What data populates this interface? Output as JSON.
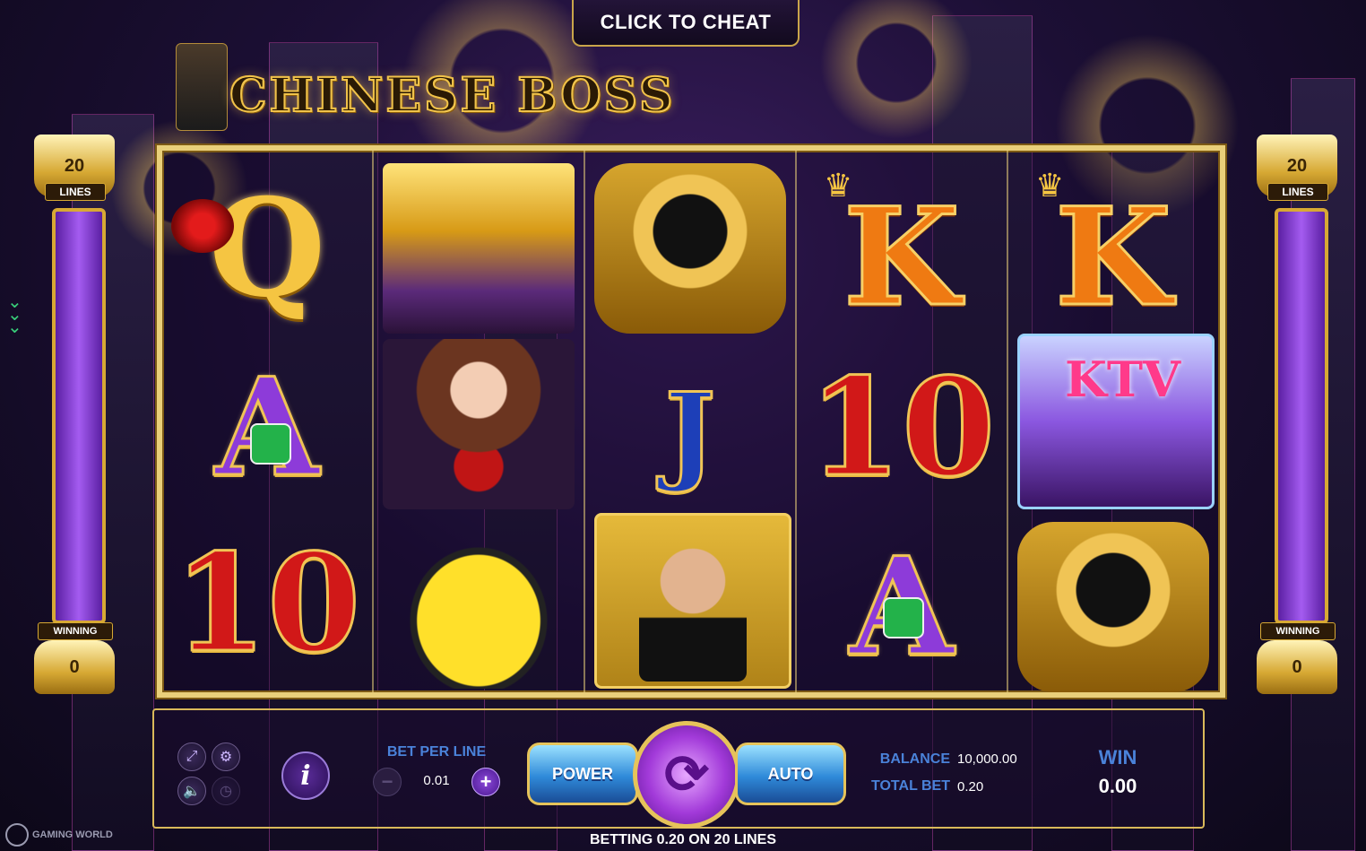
{
  "header": {
    "cheat_button": "CLICK TO CHEAT",
    "logo_text": "CHINESE BOSS"
  },
  "left_meter": {
    "lines_count": "20",
    "lines_label": "LINES",
    "winning_label": "WINNING",
    "winning_value": "0"
  },
  "right_meter": {
    "lines_count": "20",
    "lines_label": "LINES",
    "winning_label": "WINNING",
    "winning_value": "0"
  },
  "reels": [
    {
      "symbols": [
        "Q",
        "A",
        "10"
      ]
    },
    {
      "symbols": [
        "tower-building",
        "red-bikini-girl",
        "yellow-sports-car"
      ]
    },
    {
      "symbols": [
        "gold-watch",
        "J",
        "boss-man"
      ]
    },
    {
      "symbols": [
        "K",
        "10",
        "A"
      ]
    },
    {
      "symbols": [
        "K",
        "ktv-bar",
        "gold-watch"
      ]
    }
  ],
  "controls": {
    "bet_per_line_label": "BET PER LINE",
    "bet_per_line_value": "0.01",
    "minus": "−",
    "plus": "+",
    "power_label": "POWER",
    "auto_label": "AUTO",
    "balance_label": "BALANCE",
    "balance_value": "10,000.00",
    "total_bet_label": "TOTAL BET",
    "total_bet_value": "0.20",
    "win_label": "WIN",
    "win_value": "0.00",
    "info_label": "i"
  },
  "footer": {
    "betting_text": "BETTING 0.20 ON 20 LINES",
    "brand": "GAMING WORLD"
  },
  "colors": {
    "accent_gold": "#e6c35a",
    "label_blue": "#4a82d9",
    "spin_purple": "#a23ad9"
  }
}
